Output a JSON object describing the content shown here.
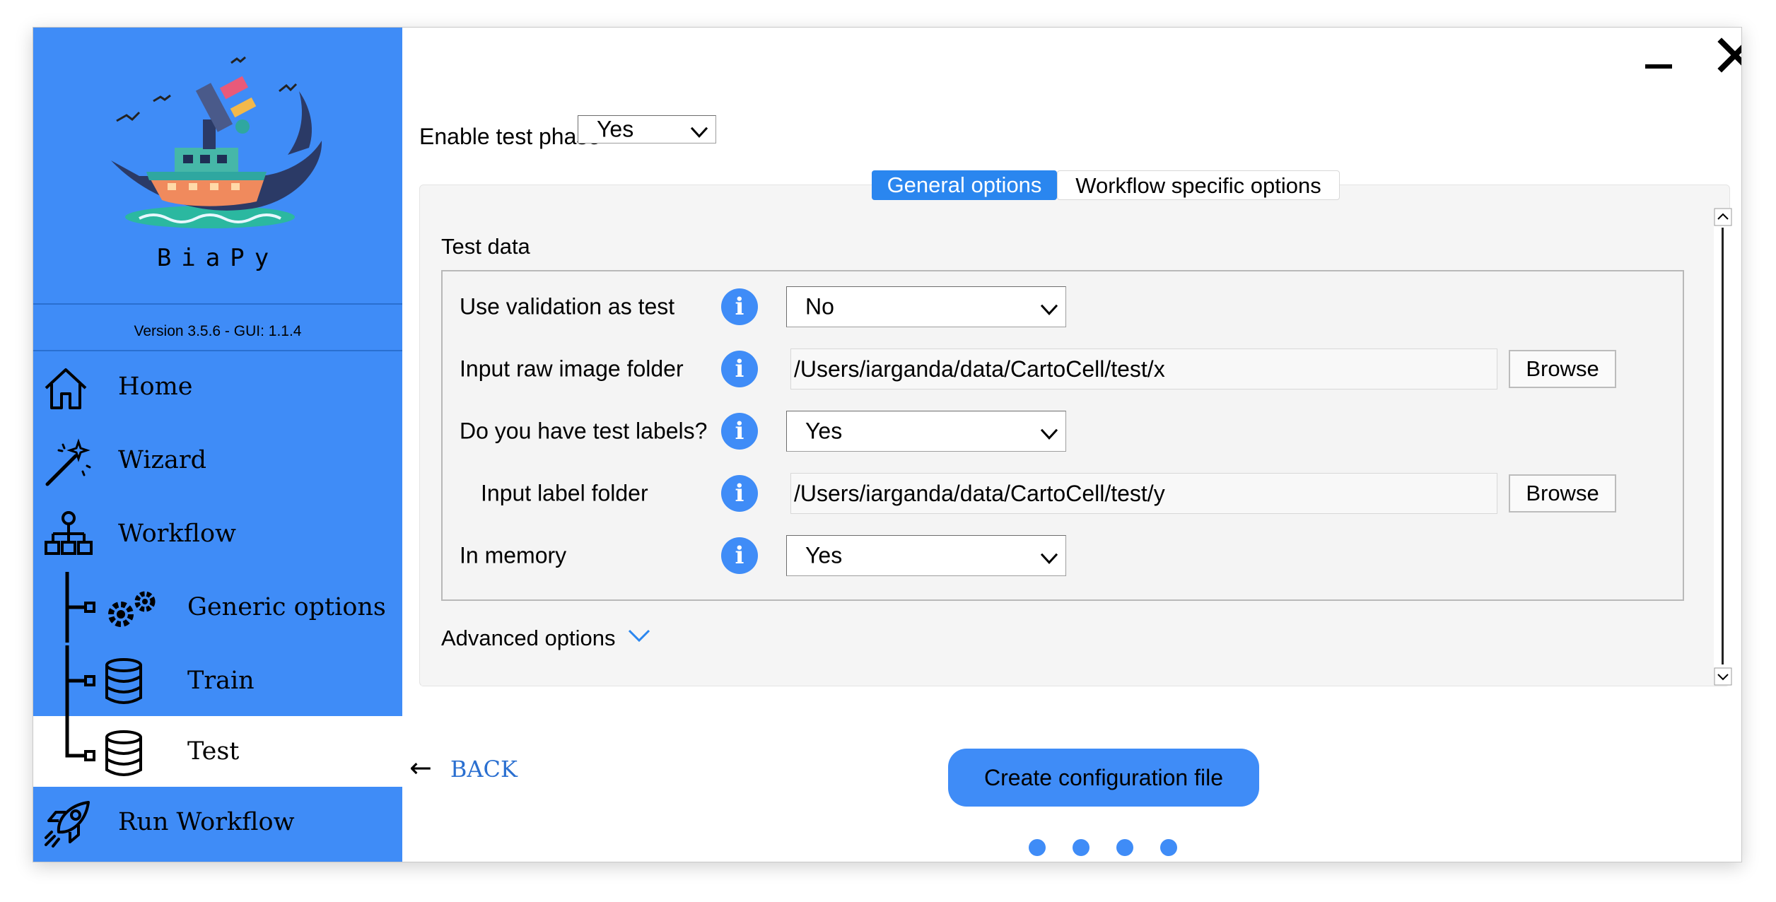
{
  "app": {
    "name": "BiaPy",
    "version": "Version 3.5.6 - GUI: 1.1.4"
  },
  "colors": {
    "sidebar": "#3f8cf7",
    "accent": "#2a86ef",
    "info_icon": "#3f8cf7",
    "link": "#2a6fd0"
  },
  "sidebar": {
    "items": [
      {
        "label": "Home",
        "icon": "home-icon"
      },
      {
        "label": "Wizard",
        "icon": "magic-wand-icon"
      },
      {
        "label": "Workflow",
        "icon": "workflow-tree-icon"
      },
      {
        "label": "Generic options",
        "icon": "gears-icon"
      },
      {
        "label": "Train",
        "icon": "database-icon"
      },
      {
        "label": "Test",
        "icon": "database-icon",
        "active": true
      },
      {
        "label": "Run Workflow",
        "icon": "rocket-icon"
      }
    ]
  },
  "window_controls": {
    "minimize": "minimize-icon",
    "close": "close-icon"
  },
  "enable_test": {
    "label": "Enable test phase",
    "value": "Yes"
  },
  "tabs": [
    {
      "label": "General options",
      "active": true
    },
    {
      "label": "Workflow specific options",
      "active": false
    }
  ],
  "test_data": {
    "title": "Test data",
    "rows": [
      {
        "label": "Use validation as test",
        "type": "select",
        "value": "No"
      },
      {
        "label": "Input raw image folder",
        "type": "path",
        "value": "/Users/iarganda/data/CartoCell/test/x",
        "button": "Browse"
      },
      {
        "label": "Do you have test labels?",
        "type": "select",
        "value": "Yes"
      },
      {
        "label": "Input label folder",
        "type": "path",
        "value": "/Users/iarganda/data/CartoCell/test/y",
        "button": "Browse"
      },
      {
        "label": "In memory",
        "type": "select",
        "value": "Yes"
      }
    ],
    "info_glyph": "i"
  },
  "advanced": {
    "label": "Advanced options"
  },
  "footer": {
    "back_arrow": "←",
    "back_label": "BACK",
    "create_label": "Create configuration file",
    "page_dots": 4
  }
}
